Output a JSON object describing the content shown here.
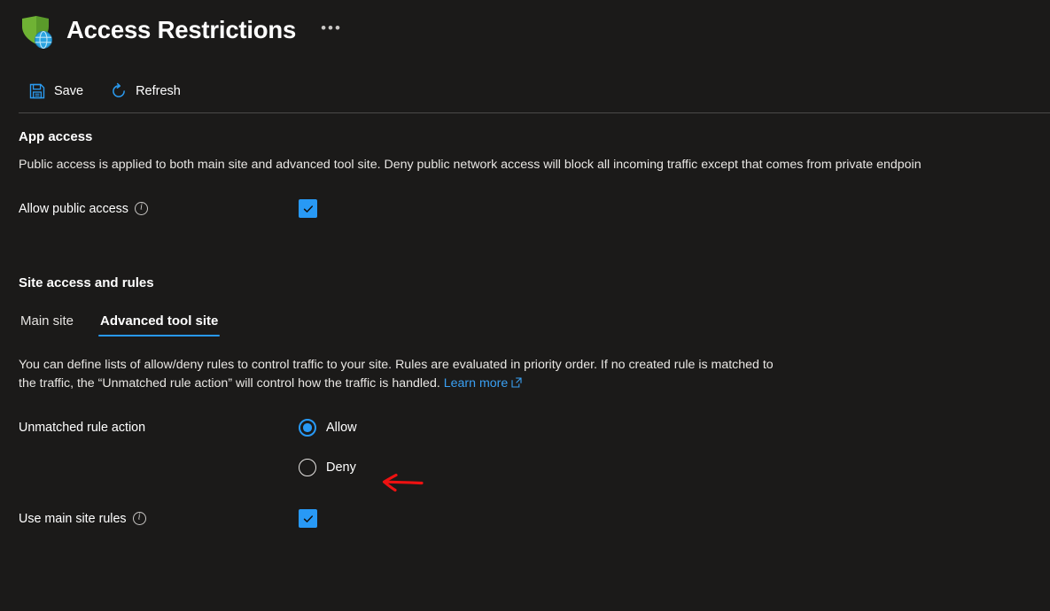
{
  "header": {
    "title": "Access Restrictions",
    "app_icon": "shield-globe-icon",
    "more_label": "•••"
  },
  "commandbar": {
    "items": [
      {
        "label": "Save",
        "icon": "save-icon"
      },
      {
        "label": "Refresh",
        "icon": "refresh-icon"
      }
    ]
  },
  "app_access": {
    "heading": "App access",
    "description": "Public access is applied to both main site and advanced tool site. Deny public network access will block all incoming traffic except that comes from private endpoin",
    "allow_public_access": {
      "label": "Allow public access",
      "info_icon": "info-icon",
      "checked": true,
      "check_glyph": "checkmark-icon"
    }
  },
  "site_access": {
    "heading": "Site access and rules",
    "tabs": [
      {
        "label": "Main site",
        "active": false
      },
      {
        "label": "Advanced tool site",
        "active": true
      }
    ],
    "description_line1": "You can define lists of allow/deny rules to control traffic to your site. Rules are evaluated in priority order. If no created rule is matched to",
    "description_line2": "the traffic, the “Unmatched rule action” will control how the traffic is handled.",
    "learn_more": "Learn more",
    "learn_more_icon": "external-link-icon",
    "unmatched_rule_action": {
      "label": "Unmatched rule action",
      "options": [
        {
          "label": "Allow",
          "selected": true
        },
        {
          "label": "Deny",
          "selected": false
        }
      ]
    },
    "use_main_site_rules": {
      "label": "Use main site rules",
      "info_icon": "info-icon",
      "checked": true,
      "check_glyph": "checkmark-icon"
    }
  },
  "annotation": {
    "type": "red-arrow-left",
    "points_to": "Deny",
    "color": "#ee1111"
  },
  "colors": {
    "background": "#1b1a19",
    "accent": "#2899f5",
    "link": "#3aa0f3",
    "divider": "#4a4a48",
    "text": "#ffffff"
  }
}
